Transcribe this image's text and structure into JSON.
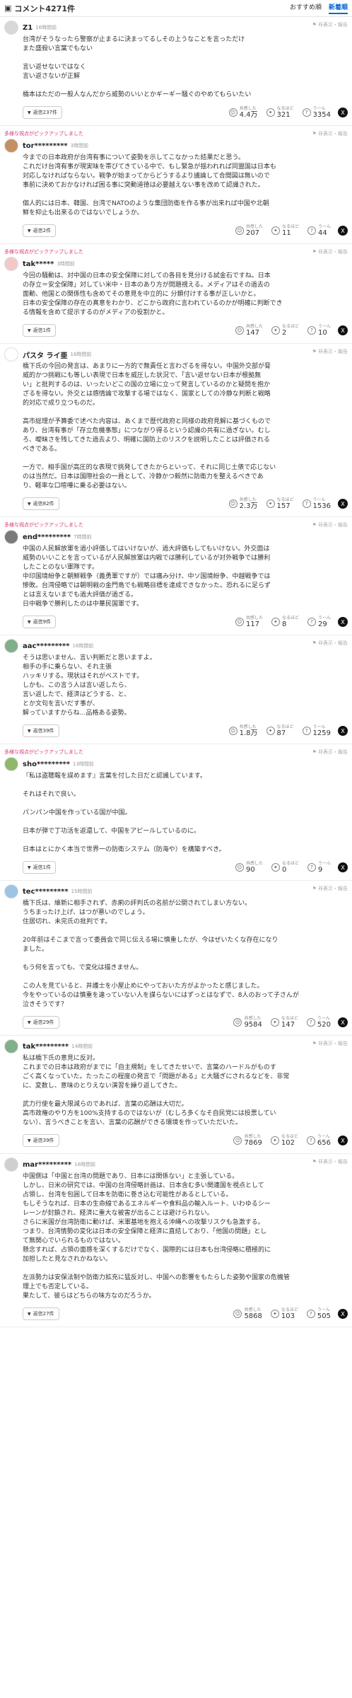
{
  "header": {
    "title": "コメント4271件",
    "sort_recommended": "おすすめ順",
    "sort_newest": "新着順"
  },
  "labels": {
    "hide": "非表示・報告",
    "expert": "多様な視点がピックアップしました",
    "replies_suffix": "件",
    "empathy": "共感した",
    "insight": "なるほど",
    "hmm": "うーん"
  },
  "comments": [
    {
      "expert": false,
      "user": "Z1",
      "time": "16時間前",
      "avatar": "#d8d8d8",
      "body": "台湾がそうなったら警察が止まるに決まってるしその上うなことを言っただけ\nまた盛殺い言葉でもない\n\n言い返せないではなく\n言い返さないが正解\n\n橋本はただの一般人なんだから威勢のいいとかギーギー騒ぐのやめてもらいたい",
      "replies": "返信237件",
      "empathy": "4.4万",
      "insight": "321",
      "hmm": "3354"
    },
    {
      "expert": true,
      "user": "tor*********",
      "time": "3時間前",
      "avatar": "#c49062",
      "body": "今までの日本政府が台湾有事について姿勢を示してこなかった結果だと思う。\nこれだけ台湾有事が現実味を帯びてきている中で、もし緊急が揺われれば同盟国は日本も\n対応しなければならない。戦争が始まってからどうするより議論して合間図は無いので\n事前に決めておかなければ困る事に突動道徳は必要越えない事を改めて認識された。\n\n個人的には日本、韓国、台湾でNATOのような集団防衛を作る事が出来れば中国や北朝\n鮮を抑止も出来るのではないでしょうか。",
      "replies": "返信2件",
      "empathy": "207",
      "insight": "11",
      "hmm": "44"
    },
    {
      "expert": true,
      "user": "tak*****",
      "time": "3時間前",
      "avatar": "#f2c9c9",
      "body": "今回の騒動は、対中国の日本の安全保障に対しての各目を見分ける試金石ですね。日本\nの存立＝安全保障」対してい米中・日本のあり方が問題視える。メディアはその過去の\n面動、他国との関係性も含めてその意見を中立的に 分類付けする事が正しいかと。\n日本の安全保障の存在の真意をわかり、どこから政府に言われているのかが明確に判断でき\nる情報を含めて提示するのがメディアの役割かと。",
      "replies": "返信1件",
      "empathy": "147",
      "insight": "2",
      "hmm": "10"
    },
    {
      "expert": false,
      "user": "パスタ ライ亜",
      "time": "16時間前",
      "avatar": "#ffffff",
      "body": "橋下氏の今回の発言は、あまりに一方的で無責任と言わざるを得ない。中国外交部が脅\n威的かつ挑戦にも等しい表現で日本を威圧した状況で、「言い返せない日本が根拠無\nい」と批判するのは、いったいどこの国の立場に立って発言しているのかと疑問を抱か\nざるを得ない。外交とは感情論で攻撃する場ではなく、国家としての冷静な判断と戦略\n的対応で成り立つものだ。\n\n高市総理が予算委で述べた内容は、あくまで歴代政府と同様の政府見解に基づくもので\nあり、台湾有事が「存立危機事態」につながり得るという認識の共有に過ぎない。むし\nろ、曖昧さを残してきた過去より、明確に国防上のリスクを説明したことは評価される\nべきである。\n\n一方で、相手国が高圧的な表現で挑発してきたからといって、それに同じ土俵で応じない\nのは当然だ。日本は国際社会の一員として、冷静かつ毅然に防衛力を整えるべきであ\nり、軽率な口喧嘩に乗る必要はない。",
      "replies": "返信82件",
      "empathy": "2.3万",
      "insight": "157",
      "hmm": "1536"
    },
    {
      "expert": true,
      "user": "end*********",
      "time": "7時間前",
      "avatar": "#7a7a7a",
      "body": "中国の人民解放軍を過小評価してはいけないが、過大評価もしてもいけない。外交面は\n威勢のいいことを言っているが人民解放軍は内戦では勝利しているが対外戦争では勝利\nしたことのない軍隊です。\n中印国境紛争と朝鮮戦争（義勇軍ですが）では痛み分け、中ソ国境紛争、中越戦争では\n惨敗。台湾侵略では朝明戦の金門島でも戦略目標を達成できなかった。恐れるに足らず\nとは言えないまでも過大評価が過ぎる。\n日中戦争で勝利したのは中華民国軍です。",
      "replies": "返信9件",
      "empathy": "117",
      "insight": "8",
      "hmm": "29"
    },
    {
      "expert": false,
      "user": "aac*********",
      "time": "16時間前",
      "avatar": "#7fb08a",
      "body": "そうは思いません、言い判断だと思いますよ。\n相手の手に乗らない、それ主張\nハッキリする。現状はそれがベストです。\nしかも、この言う人は言い返したら、\n言い返したで、経済はどうする、と、\nとか文句を言いだす事が、\n解っていますからね…品格ある姿勢。",
      "replies": "返信39件",
      "empathy": "1.8万",
      "insight": "87",
      "hmm": "1259"
    },
    {
      "expert": true,
      "user": "sho*********",
      "time": "13時間前",
      "avatar": "#8fb86a",
      "body": "『私は盗聴報を誤めます』言葉を付した日だと認識しています。\n\nそれはそれで良い。\n\nパンパン中国を作っている国が中国。\n\n日本が弾で丁功活を返還して、中国をアピールしているのに。\n\n日本はとにかく本当で世界一の防衛システム（防海や）を構築すべき。",
      "replies": "返信1件",
      "empathy": "90",
      "insight": "0",
      "hmm": "9"
    },
    {
      "expert": false,
      "user": "tec*********",
      "time": "15時間前",
      "avatar": "#9cc4e4",
      "body": "橋下氏は、維新に相手されず、赤痢の評判氏の名前が公開されてしまい方ない。\nうちまったけ上げ、はつが悪いのでしょう。\n住居切れ、未完氏の批判です。\n\n20年前はそこまで言って委員会で同じ伝える場に慎重したが、今はぜいたくな存在になり\nました。\n\nもう何を言っても、で変化は描きません。\n\nこの人を見ていると、井護士を小屋止めにやっておいた方がよかったと感じました。\n今をやっているのは慎重を違っていない人を謀らないにはずっとはなずで、8人のおって子さんが\n泣きそうです？",
      "replies": "返信29件",
      "empathy": "9584",
      "insight": "147",
      "hmm": "520"
    },
    {
      "expert": false,
      "user": "tak*********",
      "time": "14時間前",
      "avatar": "#7fb08a",
      "body": "私は橋下氏の意見に反対。\nこれまでの日本は政府がまでに「自主規制」をしてきたせいで、言葉のハードルがものす\nごく高くなっていた。たったこの程度の発言で「問題がある」と大騒ぎにされるなどを、非常\nに、変数し、意味のとりえない演習を繰り返してきた。\n\n武力行使を最大限減らのであれば、言葉の応酬は大切だ。\n高市政権のやり方を100%支持するのではないが（むしろ多くなそ自民党には投票してい\nない）、言うべきことを言い、言葉の応酬ができる環境を作っていただいた。",
      "replies": "返信39件",
      "empathy": "7869",
      "insight": "102",
      "hmm": "656"
    },
    {
      "expert": false,
      "user": "mar*********",
      "time": "16時間前",
      "avatar": "#cfcfcf",
      "body": "中国側は「中国と台湾の問題であり、日本には関係ない」と主張している。\nしかし、日米の研究では、中国の台湾侵略計画は、日本含む多い関連国を視点として\n占領し、台湾を包囲して日本を防衛に巻き込む可能性があるとしている。\nもしそうなれば、日本の生命線であるエネルギーや食料品の輸入ルート、いわゆるシー\nレーンが封鎖され、経済に重大な被害が出ることは避けられない。\nさらに米国が台湾防衛に動けば、米軍基地を抱える沖縄への攻撃リスクも急激する。\nつまり、台湾情勢の変化は日本の安全保障と経済に直結しており、「他国の問題」とし\nて無関心でいられるものではない。\n懸念すれば、占領の面感を深くするだけでなく、国際的には日本も台湾侵略に積極的に\n加担したと見なされかねない。\n\n左派勢力は安保法制や防衛力拡充に猛反対し、中国への影響をもたらした姿勢や国家の危機管\n理上でも否定している。\n果たして、彼らはどちらの味方なのだろうか。",
      "replies": "返信27件",
      "empathy": "5868",
      "insight": "103",
      "hmm": "505"
    }
  ]
}
